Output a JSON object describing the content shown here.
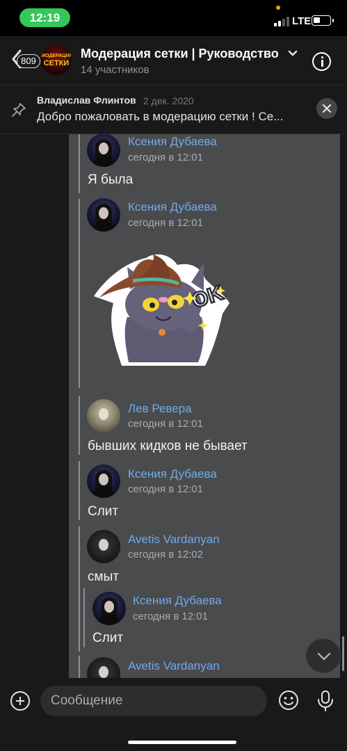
{
  "status_bar": {
    "time": "12:19",
    "network": "LTE",
    "battery_percent": 30
  },
  "header": {
    "unread_count": "809",
    "avatar_text_line1": "МОДЕРАЦИЯ",
    "avatar_text_line2": "СЕТКИ",
    "title": "Модерация сетки | Руководство",
    "subtitle": "14 участников",
    "icons": {
      "back": "chevron-left-icon",
      "expand": "chevron-down-icon",
      "info": "info-icon"
    }
  },
  "pinned": {
    "author": "Владислав Флинтов",
    "date": "2 дек. 2020",
    "text": "Добро пожаловать в модерацию сетки ! Се...",
    "icons": {
      "pin": "pin-icon",
      "close": "close-icon"
    }
  },
  "messages": [
    {
      "author": "Ксения Дубаева",
      "time": "сегодня в 12:01",
      "text": "Я была",
      "avatar": "ks"
    },
    {
      "author": "Ксения Дубаева",
      "time": "сегодня в 12:01",
      "sticker": "cat-witch-ok-sticker",
      "sticker_text": "OK",
      "avatar": "ks"
    },
    {
      "author": "Лев Ревера",
      "time": "сегодня в 12:01",
      "text": "бывших кидков не бывает",
      "avatar": "lev"
    },
    {
      "author": "Ксения Дубаева",
      "time": "сегодня в 12:01",
      "text": "Слит",
      "avatar": "ks"
    },
    {
      "author": "Avetis Vardanyan",
      "time": "сегодня в 12:02",
      "text": "смыт",
      "avatar": "av",
      "reply": {
        "author": "Ксения Дубаева",
        "time": "сегодня в 12:01",
        "text": "Слит"
      }
    },
    {
      "author": "Avetis Vardanyan",
      "avatar": "av"
    }
  ],
  "composer": {
    "placeholder": "Сообщение",
    "icons": {
      "attach": "plus-circle-icon",
      "emoji": "emoji-icon",
      "voice": "microphone-icon",
      "scroll": "chevron-down-icon"
    }
  },
  "colors": {
    "background": "#19191a",
    "forward_panel": "#4a4b4d",
    "name": "#71aaeb",
    "time_pill": "#34c759"
  }
}
